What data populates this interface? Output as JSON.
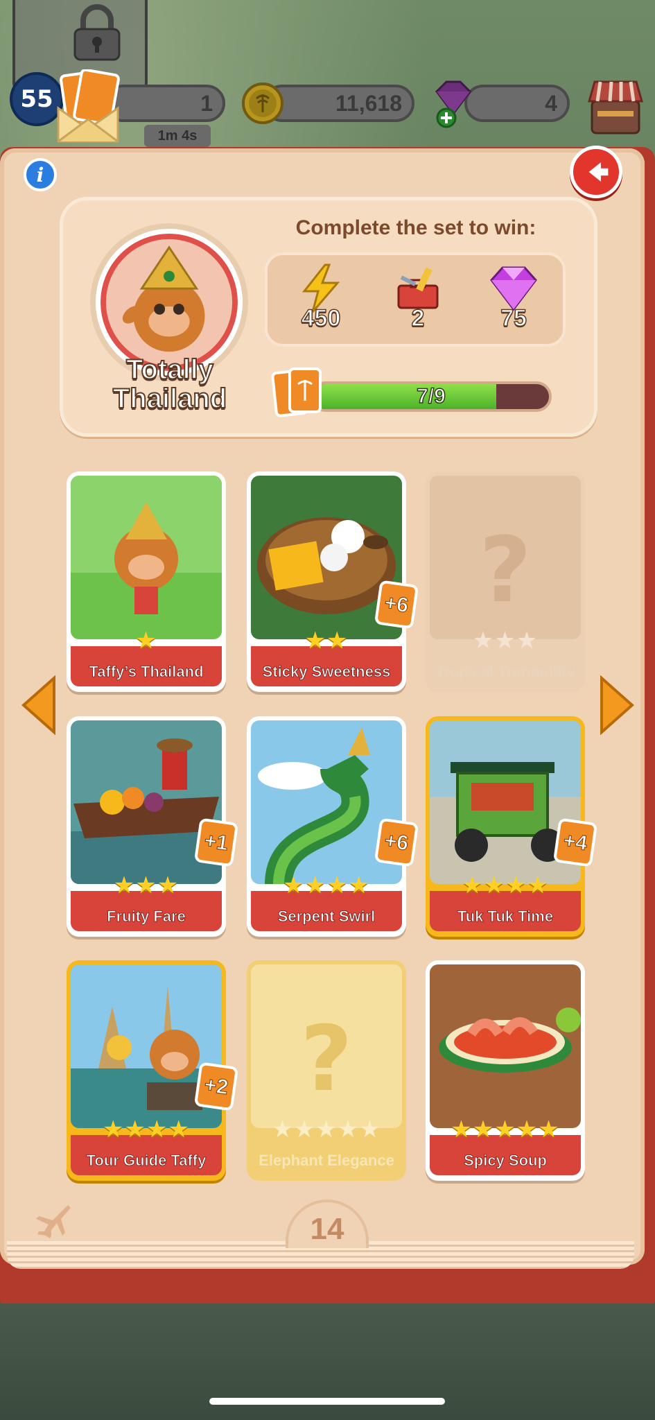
{
  "hud": {
    "level": "55",
    "energy": "1",
    "timer": "1m 4s",
    "coins": "11,618",
    "gems": "4"
  },
  "set": {
    "title_line1": "Totally",
    "title_line2": "Thailand",
    "reward_heading": "Complete the set to win:",
    "rewards": [
      {
        "icon": "lightning-icon",
        "value": "450"
      },
      {
        "icon": "toolbox-icon",
        "value": "2"
      },
      {
        "icon": "gem-icon",
        "value": "75"
      }
    ],
    "progress_text": "7/9",
    "progress_fraction": 0.7778
  },
  "cards": [
    {
      "name": "Taffy’s Thailand",
      "stars": 1,
      "collected": true,
      "gold": false,
      "duplicates": ""
    },
    {
      "name": "Sticky Sweetness",
      "stars": 2,
      "collected": true,
      "gold": false,
      "duplicates": "+6"
    },
    {
      "name": "Tropical Tranquility",
      "stars": 3,
      "collected": false,
      "gold": false,
      "duplicates": ""
    },
    {
      "name": "Fruity Fare",
      "stars": 3,
      "collected": true,
      "gold": false,
      "duplicates": "+1"
    },
    {
      "name": "Serpent Swirl",
      "stars": 4,
      "collected": true,
      "gold": false,
      "duplicates": "+6"
    },
    {
      "name": "Tuk Tuk Time",
      "stars": 4,
      "collected": true,
      "gold": true,
      "duplicates": "+4"
    },
    {
      "name": "Tour Guide Taffy",
      "stars": 4,
      "collected": true,
      "gold": true,
      "duplicates": "+2"
    },
    {
      "name": "Elephant Elegance",
      "stars": 5,
      "collected": false,
      "gold": true,
      "duplicates": ""
    },
    {
      "name": "Spicy Soup",
      "stars": 5,
      "collected": true,
      "gold": false,
      "duplicates": ""
    }
  ],
  "page_number": "14",
  "colors": {
    "book": "#f0d2b4",
    "label_red": "#d8433a",
    "gold_frame": "#f6b81a",
    "progress_green": "#4cb22a"
  }
}
